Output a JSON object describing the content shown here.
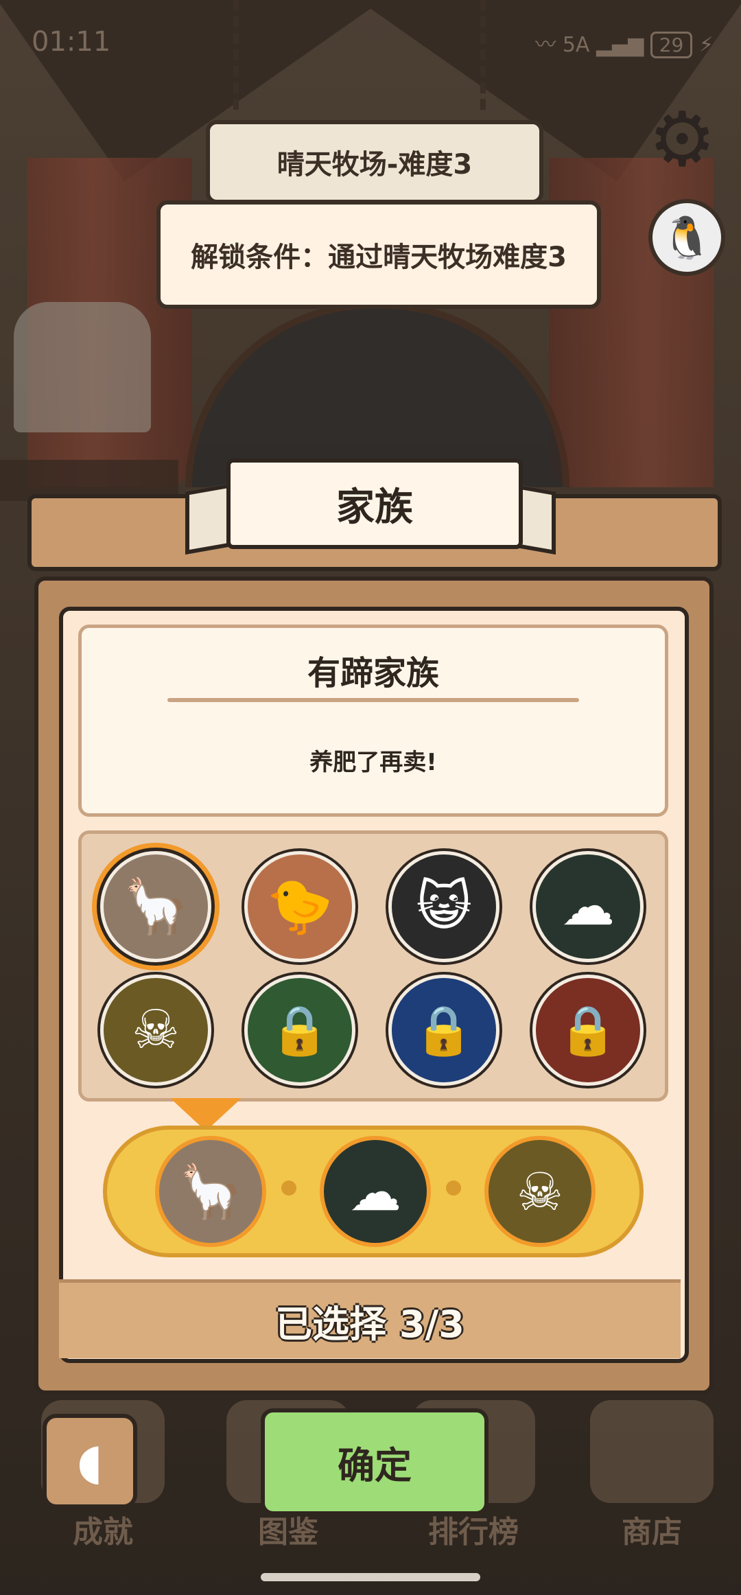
{
  "status_bar": {
    "time": "01:11",
    "network": "5A",
    "battery": "29"
  },
  "header": {
    "stage_title": "晴天牧场-难度3",
    "unlock_condition": "解锁条件：通过晴天牧场难度3"
  },
  "panel": {
    "ribbon_title": "家族",
    "family_name": "有蹄家族",
    "family_desc": "养肥了再卖!",
    "selected_text": "已选择 3/3"
  },
  "families": [
    {
      "color": "#8f7a68",
      "icon": "llama-icon",
      "glyph": "🦙",
      "locked": false,
      "selected": true
    },
    {
      "color": "#b8704a",
      "icon": "bird-icon",
      "glyph": "🐤",
      "locked": false,
      "selected": false
    },
    {
      "color": "#2a2a2a",
      "icon": "cat-icon",
      "glyph": "😺",
      "locked": false,
      "selected": false
    },
    {
      "color": "#27352e",
      "icon": "blob-icon",
      "glyph": "☁",
      "locked": false,
      "selected": false
    },
    {
      "color": "#6b5a24",
      "icon": "skull-icon",
      "glyph": "☠",
      "locked": false,
      "selected": false
    },
    {
      "color": "#2f5a32",
      "icon": "lock-icon",
      "glyph": "🔒",
      "locked": true,
      "selected": false
    },
    {
      "color": "#1d3e78",
      "icon": "lock-icon",
      "glyph": "🔒",
      "locked": true,
      "selected": false
    },
    {
      "color": "#7b2e22",
      "icon": "lock-icon",
      "glyph": "🔒",
      "locked": true,
      "selected": false
    }
  ],
  "chosen": [
    {
      "color": "#8f7a68",
      "icon": "llama-icon",
      "glyph": "🦙"
    },
    {
      "color": "#27352e",
      "icon": "blob-icon",
      "glyph": "☁"
    },
    {
      "color": "#6b5a24",
      "icon": "skull-icon",
      "glyph": "☠"
    }
  ],
  "nav": {
    "achievements": "成就",
    "collection": "图鉴",
    "leaderboard": "排行榜",
    "shop": "商店",
    "confirm": "确定"
  }
}
